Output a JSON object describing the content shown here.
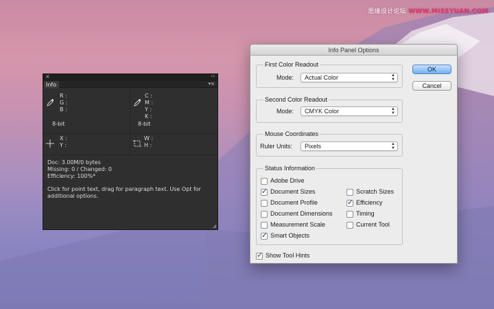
{
  "watermark": {
    "prefix": "思缘设计论坛",
    "site": "WWW.MISSYUAN.COM"
  },
  "info_panel": {
    "close_glyph": "×",
    "collapse_glyph": "‹‹",
    "menu_glyph": "▾≡",
    "tab": "Info",
    "rgb": {
      "r": "R :",
      "g": "G :",
      "b": "B :",
      "bitdepth": "8-bit"
    },
    "cmyk": {
      "c": "C :",
      "m": "M :",
      "y": "Y :",
      "k": "K :",
      "bitdepth": "8-bit"
    },
    "xy": {
      "x": "X :",
      "y": "Y :"
    },
    "wh": {
      "w": "W :",
      "h": "H :"
    },
    "status": {
      "doc": "Doc: 3.00M/0 bytes",
      "missing": "Missing: 0 / Changed: 0",
      "efficiency": "Efficiency: 100%*"
    },
    "hint_line1": "Click for point text, drag for paragraph text. Use Opt for",
    "hint_line2": "additional options."
  },
  "dialog": {
    "title": "Info Panel Options",
    "first": {
      "title": "First Color Readout",
      "mode_label": "Mode:",
      "mode_value": "Actual Color"
    },
    "second": {
      "title": "Second Color Readout",
      "mode_label": "Mode:",
      "mode_value": "CMYK Color"
    },
    "mouse": {
      "title": "Mouse Coordinates",
      "units_label": "Ruler Units:",
      "units_value": "Pixels"
    },
    "status": {
      "title": "Status Information",
      "left": [
        {
          "label": "Adobe Drive",
          "checked": false
        },
        {
          "label": "Document Sizes",
          "checked": true
        },
        {
          "label": "Document Profile",
          "checked": false
        },
        {
          "label": "Document Dimensions",
          "checked": false
        },
        {
          "label": "Measurement Scale",
          "checked": false
        },
        {
          "label": "Smart Objects",
          "checked": true
        }
      ],
      "right": [
        {
          "label": "Scratch Sizes",
          "checked": false
        },
        {
          "label": "Efficiency",
          "checked": true
        },
        {
          "label": "Timing",
          "checked": false
        },
        {
          "label": "Current Tool",
          "checked": false
        }
      ]
    },
    "tool_hints": {
      "label": "Show Tool Hints",
      "checked": true
    },
    "ok": "OK",
    "cancel": "Cancel"
  },
  "colors": {
    "accent": "#6fb0f1",
    "panel_bg": "#2f2f2f",
    "dialog_bg": "#ececec"
  }
}
